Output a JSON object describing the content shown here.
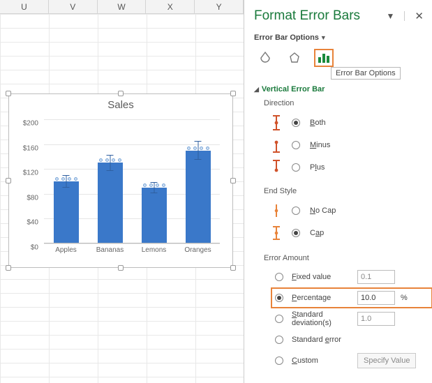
{
  "columns": [
    "U",
    "V",
    "W",
    "X",
    "Y"
  ],
  "chart_data": {
    "type": "bar",
    "title": "Sales",
    "categories": [
      "Apples",
      "Bananas",
      "Lemons",
      "Oranges"
    ],
    "values": [
      100,
      130,
      90,
      150
    ],
    "ylabel": "",
    "ylim": [
      0,
      200
    ],
    "yticks": [
      "$0",
      "$40",
      "$80",
      "$120",
      "$160",
      "$200"
    ],
    "error_percent": 10,
    "currency_prefix": "$"
  },
  "panel": {
    "title": "Format Error Bars",
    "subtitle": "Error Bar Options",
    "tooltip": "Error Bar Options",
    "section": "Vertical Error Bar",
    "direction_label": "Direction",
    "direction": {
      "both": "Both",
      "minus": "Minus",
      "plus": "Plus",
      "selected": "both"
    },
    "endstyle_label": "End Style",
    "endstyle": {
      "nocap": "No Cap",
      "cap": "Cap",
      "selected": "cap"
    },
    "amount_label": "Error Amount",
    "amounts": {
      "fixed_label": "Fixed value",
      "fixed_value": "0.1",
      "percent_label": "Percentage",
      "percent_value": "10.0",
      "percent_suffix": "%",
      "stddev_label": "Standard deviation(s)",
      "stddev_value": "1.0",
      "stderr_label": "Standard error",
      "custom_label": "Custom",
      "custom_button": "Specify Value",
      "selected": "percentage"
    }
  }
}
